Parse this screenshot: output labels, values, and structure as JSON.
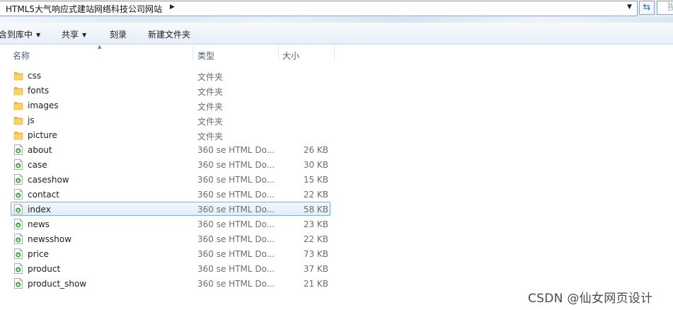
{
  "address_bar": {
    "path": "HTML5大气响应式建站网络科技公司网站",
    "search_placeholder": "搜"
  },
  "toolbar": {
    "include_label": "含到库中",
    "share_label": "共享",
    "burn_label": "刻录",
    "new_folder_label": "新建文件夹"
  },
  "columns": {
    "name": "名称",
    "type": "类型",
    "size": "大小"
  },
  "files": [
    {
      "name": "css",
      "type": "文件夹",
      "size": "",
      "icon": "folder-icon"
    },
    {
      "name": "fonts",
      "type": "文件夹",
      "size": "",
      "icon": "folder-icon"
    },
    {
      "name": "images",
      "type": "文件夹",
      "size": "",
      "icon": "folder-icon"
    },
    {
      "name": "js",
      "type": "文件夹",
      "size": "",
      "icon": "folder-icon"
    },
    {
      "name": "picture",
      "type": "文件夹",
      "size": "",
      "icon": "folder-icon"
    },
    {
      "name": "about",
      "type": "360 se HTML Do...",
      "size": "26 KB",
      "icon": "html-file-icon"
    },
    {
      "name": "case",
      "type": "360 se HTML Do...",
      "size": "30 KB",
      "icon": "html-file-icon"
    },
    {
      "name": "caseshow",
      "type": "360 se HTML Do...",
      "size": "15 KB",
      "icon": "html-file-icon"
    },
    {
      "name": "contact",
      "type": "360 se HTML Do...",
      "size": "22 KB",
      "icon": "html-file-icon"
    },
    {
      "name": "index",
      "type": "360 se HTML Do...",
      "size": "58 KB",
      "icon": "html-file-icon",
      "selected": true
    },
    {
      "name": "news",
      "type": "360 se HTML Do...",
      "size": "23 KB",
      "icon": "html-file-icon"
    },
    {
      "name": "newsshow",
      "type": "360 se HTML Do...",
      "size": "22 KB",
      "icon": "html-file-icon"
    },
    {
      "name": "price",
      "type": "360 se HTML Do...",
      "size": "73 KB",
      "icon": "html-file-icon"
    },
    {
      "name": "product",
      "type": "360 se HTML Do...",
      "size": "37 KB",
      "icon": "html-file-icon"
    },
    {
      "name": "product_show",
      "type": "360 se HTML Do...",
      "size": "21 KB",
      "icon": "html-file-icon"
    }
  ],
  "watermark": "CSDN @仙女网页设计",
  "colors": {
    "selection_border": "#84acdd",
    "selection_fill": "#e1ecfa",
    "folder_yellow": "#f2c94c",
    "html_icon_green": "#3aa33a"
  }
}
